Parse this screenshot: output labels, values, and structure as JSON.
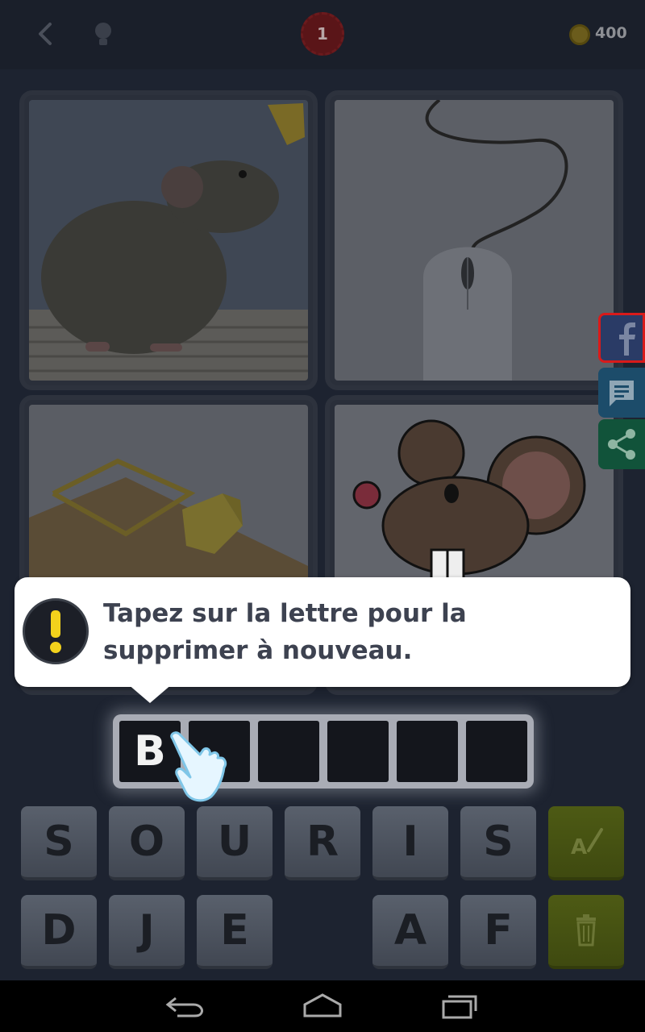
{
  "header": {
    "level": "1",
    "coins": "400",
    "icons": [
      "back-arrow-icon",
      "lightbulb-icon",
      "coin-icon"
    ]
  },
  "pictures": [
    {
      "name": "rat-photo"
    },
    {
      "name": "computer-mouse-photo"
    },
    {
      "name": "mousetrap-photo"
    },
    {
      "name": "cartoon-mouse-image"
    }
  ],
  "side_buttons": [
    "facebook-icon",
    "chat-icon",
    "share-icon"
  ],
  "tooltip": {
    "text": "Tapez sur la lettre pour la supprimer à nouveau."
  },
  "answer": {
    "slots": [
      "B",
      "",
      "",
      "",
      "",
      ""
    ]
  },
  "keyboard": {
    "row1": [
      "S",
      "O",
      "U",
      "R",
      "I",
      "S"
    ],
    "row2": [
      "D",
      "J",
      "E",
      "",
      "A",
      "F"
    ],
    "tools": [
      "reveal-letter-icon",
      "trash-icon"
    ]
  },
  "colors": {
    "background": "#1d2330",
    "facebook": "#2a3b66",
    "chat": "#1c4c6a",
    "share": "#11533a",
    "tool_button": "#4d5a14"
  }
}
